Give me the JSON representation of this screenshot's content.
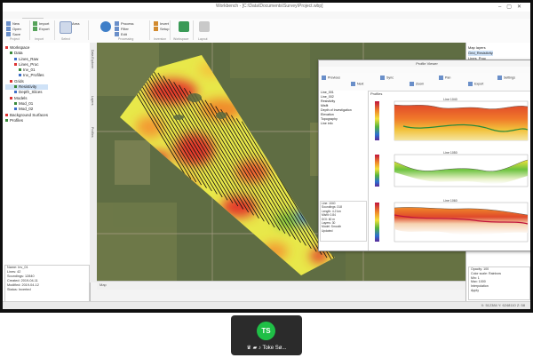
{
  "app": {
    "title": "Workbench - [C:\\Data\\Documents\\Survey\\Project.wbp]",
    "tabs": [
      "File",
      "Home",
      "Data",
      "View",
      "Processing",
      "Inversion",
      "Tools",
      "Help"
    ],
    "active_tab": "Home"
  },
  "ribbon": {
    "groups": [
      {
        "name": "Project",
        "items": [
          "New",
          "Open",
          "Save"
        ]
      },
      {
        "name": "Import",
        "items": [
          "Import",
          "Export"
        ]
      },
      {
        "name": "Select",
        "items": [
          "Select",
          "Area"
        ]
      },
      {
        "name": "Processing",
        "items": [
          "Process",
          "Filter",
          "Edit"
        ]
      },
      {
        "name": "Inversion",
        "items": [
          "Invert",
          "Setup"
        ]
      },
      {
        "name": "Workspace",
        "items": [
          "Workspace"
        ]
      },
      {
        "name": "Layout",
        "items": [
          "Layout"
        ]
      }
    ]
  },
  "tree": [
    "Workspace",
    "Data",
    "Lines_Raw",
    "Lines_Proc",
    "Inv_01",
    "Inv_Profiles",
    "Grids",
    "Resistivity",
    "Depth_Slices",
    "Models",
    "Mod_01",
    "Mod_02",
    "Background Surfaces",
    "Profiles"
  ],
  "selected_tree_index": 7,
  "properties": [
    "Name: Inv_01",
    "Lines: 42",
    "Soundings: 12840",
    "Created: 2019-04-11",
    "Modified: 2019-04-12",
    "Status: Inverted"
  ],
  "side_tabs": [
    "Data Explorer",
    "Layers",
    "Profiles"
  ],
  "map_bottom": "Map",
  "status": "X: 512384  Y: 6248110  Z: 58",
  "profile_window": {
    "title": "Profile Viewer",
    "tabs": [
      "Home",
      "Edit",
      "View"
    ],
    "active_tab": "Edit",
    "ribbon_items": [
      "Previous",
      "Next",
      "Sync",
      "Zoom",
      "Pan",
      "Export",
      "Settings"
    ],
    "left_items": [
      "Line_001",
      "Line_002",
      "Resistivity",
      "Misfit",
      "Depth of Investigation",
      "Elevation",
      "Topography",
      "Line info"
    ],
    "info": [
      "Line: 1040",
      "Soundings: 318",
      "Length: 4.2 km",
      "Misfit: 0.84",
      "DOI: 60 m",
      "Layers: 30",
      "Model: Smooth",
      "Updated"
    ],
    "plot_header": "Profiles",
    "plots": [
      "Line 1040",
      "Line 1050",
      "Line 1060"
    ]
  },
  "right_panel": {
    "items": [
      "Map layers",
      "Grid_Resistivity",
      "Lines_Proc",
      "Background",
      "Topography",
      "Boundary",
      "Labels"
    ],
    "selected_index": 1,
    "bottom": [
      "Opacity: 100",
      "Color scale: Rainbow",
      "Min: 1",
      "Max: 1000",
      "Interpolation",
      "Apply"
    ]
  },
  "participant": {
    "initials": "TS",
    "name": "Toke Sø...",
    "avatar_color": "#1fbf46"
  }
}
